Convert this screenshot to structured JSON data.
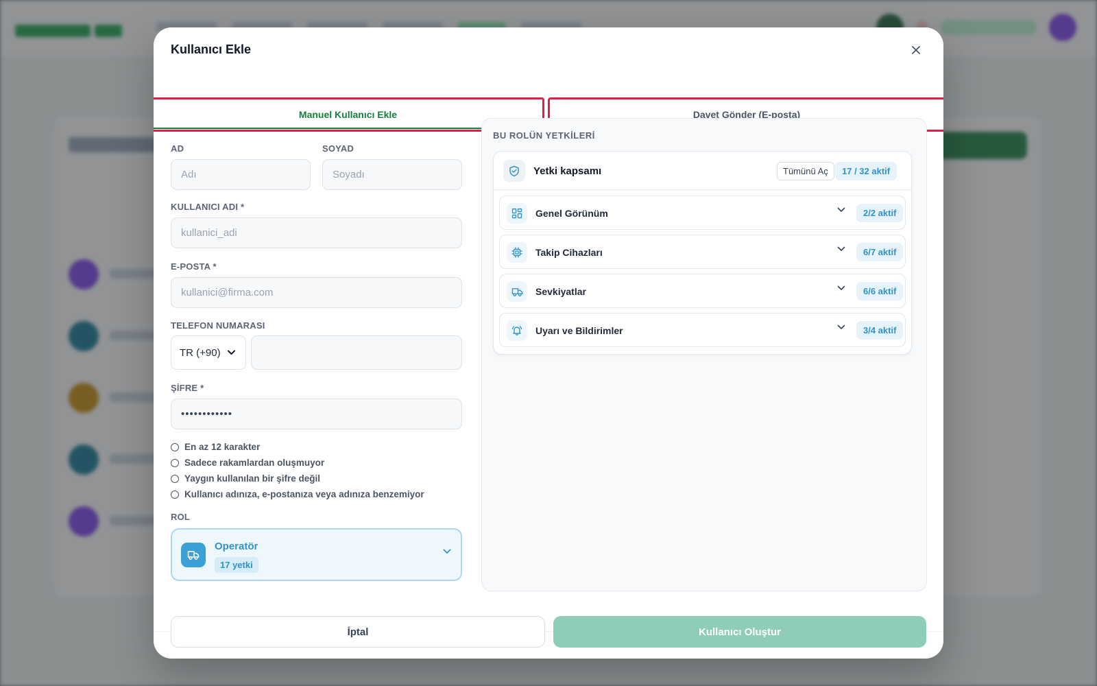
{
  "modal": {
    "title": "Kullanıcı Ekle",
    "close_icon": "close-icon"
  },
  "tabs": [
    {
      "label": "Manuel Kullanıcı Ekle",
      "active": true
    },
    {
      "label": "Davet Gönder (E-posta)",
      "active": false
    }
  ],
  "form": {
    "first_name": {
      "label": "AD",
      "placeholder": "Adı",
      "value": ""
    },
    "last_name": {
      "label": "SOYAD",
      "placeholder": "Soyadı",
      "value": ""
    },
    "username": {
      "label": "KULLANICI ADI *",
      "placeholder": "kullanici_adi",
      "value": ""
    },
    "email": {
      "label": "E-POSTA *",
      "placeholder": "kullanici@firma.com",
      "value": ""
    },
    "phone": {
      "label": "TELEFON NUMARASI",
      "country_code": "TR (+90)",
      "value": ""
    },
    "password": {
      "label": "ŞİFRE *",
      "value": "••••••••••••"
    },
    "password_rules": [
      "En az 12 karakter",
      "Sadece rakamlardan oluşmuyor",
      "Yaygın kullanılan bir şifre değil",
      "Kullanıcı adınıza, e-postanıza veya adınıza benzemiyor"
    ],
    "role": {
      "label": "ROL",
      "selected": "Operatör",
      "badge": "17 yetki",
      "icon": "truck-icon"
    }
  },
  "permissions": {
    "heading": "BU ROLÜN YETKİLERİ",
    "scope_title": "Yetki kapsamı",
    "expand_all": "Tümünü Aç",
    "total": "17 / 32 aktif",
    "groups": [
      {
        "label": "Genel Görünüm",
        "count": "2/2 aktif",
        "icon": "dashboard-grid-icon"
      },
      {
        "label": "Takip Cihazları",
        "count": "6/7 aktif",
        "icon": "chip-icon"
      },
      {
        "label": "Sevkiyatlar",
        "count": "6/6 aktif",
        "icon": "truck-icon"
      },
      {
        "label": "Uyarı ve Bildirimler",
        "count": "3/4 aktif",
        "icon": "bell-icon"
      }
    ]
  },
  "footer": {
    "cancel": "İptal",
    "create": "Kullanıcı Oluştur"
  },
  "colors": {
    "brand_green": "#15803d",
    "accent_blue": "#2f93c9",
    "tab_highlight": "#e11d48",
    "create_disabled": "#8fcdb6"
  }
}
